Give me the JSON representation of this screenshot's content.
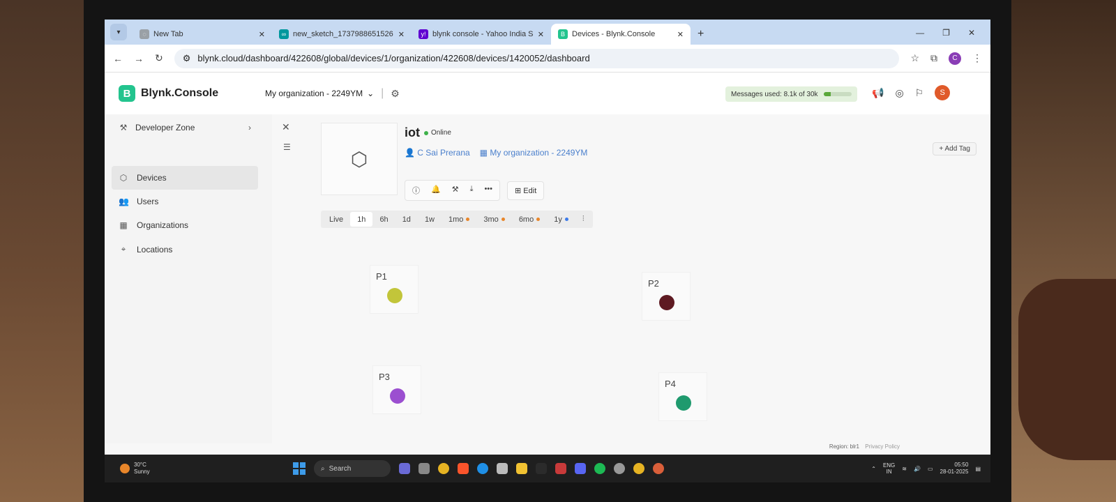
{
  "browser": {
    "tabs": [
      {
        "title": "New Tab",
        "favicon_color": "#9aa0a6",
        "favicon": "◌"
      },
      {
        "title": "new_sketch_1737988651526 -...",
        "favicon_color": "#00979d",
        "favicon": "∞"
      },
      {
        "title": "blynk console - Yahoo India Se...",
        "favicon_color": "#5f01d1",
        "favicon": "y!"
      },
      {
        "title": "Devices - Blynk.Console",
        "favicon_color": "#23c48e",
        "favicon": "B"
      }
    ],
    "url": "blynk.cloud/dashboard/422608/global/devices/1/organization/422608/devices/1420052/dashboard",
    "profile_initial": "C"
  },
  "header": {
    "brand": "Blynk.Console",
    "org": "My organization - 2249YM",
    "messages_used": "Messages used: 8.1k of 30k",
    "messages_fraction": 0.27,
    "user_initial": "S"
  },
  "sidebar": {
    "developer_zone": "Developer Zone",
    "items": [
      {
        "label": "Devices",
        "icon": "cube-icon",
        "active": true
      },
      {
        "label": "Users",
        "icon": "users-icon",
        "active": false
      },
      {
        "label": "Organizations",
        "icon": "building-icon",
        "active": false
      },
      {
        "label": "Locations",
        "icon": "location-pin-icon",
        "active": false
      }
    ]
  },
  "device": {
    "name": "iot",
    "status": "Online",
    "owner": "C Sai Prerana",
    "organization": "My organization - 2249YM",
    "add_tag": "Add Tag",
    "edit": "Edit"
  },
  "time_ranges": [
    {
      "label": "Live",
      "active": false,
      "dot": ""
    },
    {
      "label": "1h",
      "active": true,
      "dot": ""
    },
    {
      "label": "6h",
      "active": false,
      "dot": ""
    },
    {
      "label": "1d",
      "active": false,
      "dot": ""
    },
    {
      "label": "1w",
      "active": false,
      "dot": ""
    },
    {
      "label": "1mo",
      "active": false,
      "dot": "#e8862a"
    },
    {
      "label": "3mo",
      "active": false,
      "dot": "#e8862a"
    },
    {
      "label": "6mo",
      "active": false,
      "dot": "#e8862a"
    },
    {
      "label": "1y",
      "active": false,
      "dot": "#3d7be9"
    }
  ],
  "widgets": [
    {
      "label": "P1",
      "color": "#c2c53a"
    },
    {
      "label": "P2",
      "color": "#5e1a22"
    },
    {
      "label": "P3",
      "color": "#9b4fd0"
    },
    {
      "label": "P4",
      "color": "#1f9a6e"
    }
  ],
  "footer": {
    "region": "Region: blr1",
    "privacy": "Privacy Policy"
  },
  "taskbar": {
    "temperature": "30°C",
    "condition": "Sunny",
    "search": "Search",
    "lang": "ENG",
    "region": "IN",
    "time": "05:50",
    "date": "28-01-2025"
  }
}
